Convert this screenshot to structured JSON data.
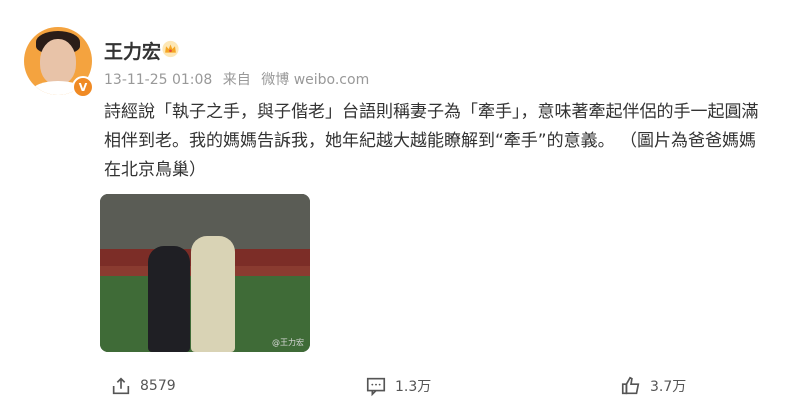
{
  "post": {
    "author": "王力宏",
    "timestamp": "13-11-25 01:08",
    "source_prefix": "来自",
    "source": "微博 weibo.com",
    "verified_badge": "V",
    "text": "詩經說「執子之手，與子偕老」台語則稱妻子為「牽手」，意味著牽起伴侶的手一起圓滿相伴到老。我的媽媽告訴我，她年紀越大越能瞭解到“牽手”的意義。 （圖片為爸爸媽媽在北京鳥巢）",
    "image_watermark": "@王力宏"
  },
  "actions": {
    "share_count": "8579",
    "comment_count": "1.3万",
    "like_count": "3.7万"
  },
  "colors": {
    "avatar_bg": "#f4a33f",
    "verified": "#f08a24",
    "crown": "#f5a623",
    "meta_text": "#999999"
  },
  "icons": {
    "share": "share-icon",
    "comment": "comment-icon",
    "like": "thumbs-up-icon",
    "crown": "crown-icon",
    "verified": "verified-badge-icon"
  }
}
